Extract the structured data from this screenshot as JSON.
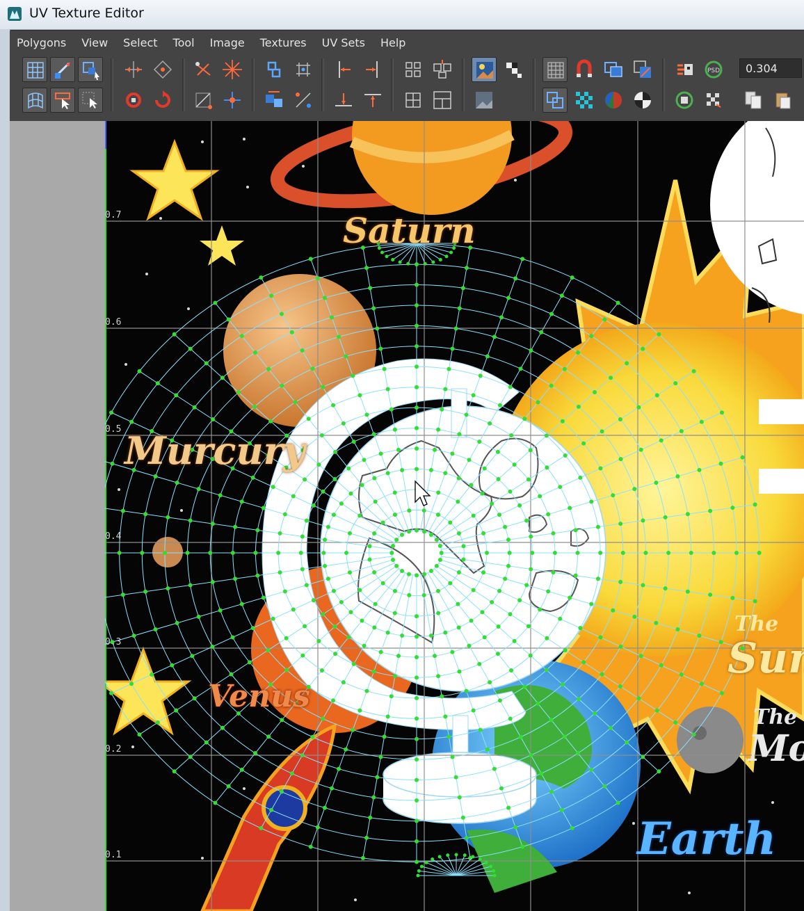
{
  "window": {
    "title": "UV Texture Editor",
    "icon": "maya-app-icon"
  },
  "menu": [
    "Polygons",
    "View",
    "Select",
    "Tool",
    "Image",
    "Textures",
    "UV Sets",
    "Help"
  ],
  "toolbar": {
    "value_field": "0.304",
    "colors": {
      "bg": "#444444",
      "active": "#6d8bb0"
    }
  },
  "editor": {
    "grid_labels": [
      "0.7",
      "0.6",
      "0.5",
      "0.4",
      "0.3",
      "0.2",
      "0.1"
    ],
    "texture_labels": {
      "saturn": "Saturn",
      "mercury": "Murcury",
      "venus": "Venus",
      "the1": "The",
      "sun": "Sun",
      "the2": "The",
      "moon": "Mo",
      "earth": "Earth"
    },
    "colors": {
      "uv_vertex": "#33dd33",
      "uv_edge": "#8be0ff",
      "grid": "#888888",
      "cursor_highlight": "#f5e800"
    }
  }
}
